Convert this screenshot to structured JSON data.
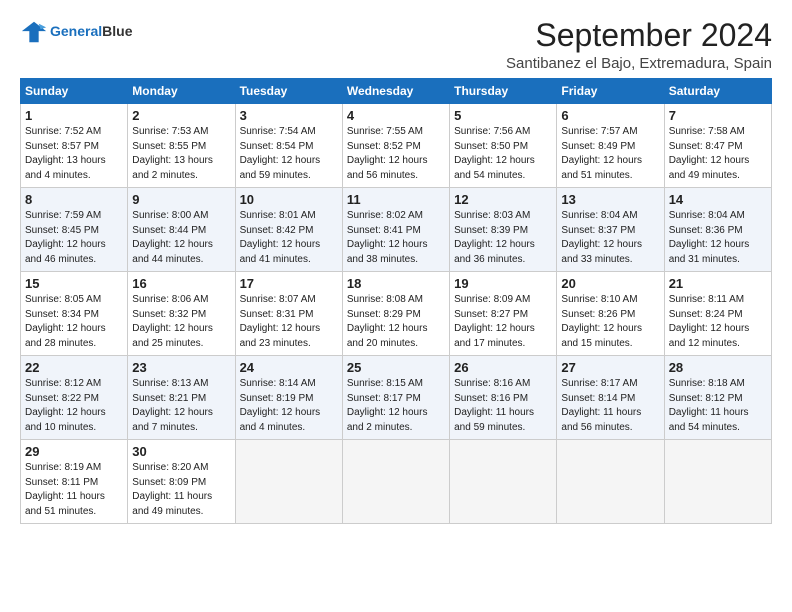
{
  "header": {
    "logo_line1": "General",
    "logo_line2": "Blue",
    "title": "September 2024",
    "subtitle": "Santibanez el Bajo, Extremadura, Spain"
  },
  "weekdays": [
    "Sunday",
    "Monday",
    "Tuesday",
    "Wednesday",
    "Thursday",
    "Friday",
    "Saturday"
  ],
  "weeks": [
    [
      {
        "day": "1",
        "info": "Sunrise: 7:52 AM\nSunset: 8:57 PM\nDaylight: 13 hours\nand 4 minutes."
      },
      {
        "day": "2",
        "info": "Sunrise: 7:53 AM\nSunset: 8:55 PM\nDaylight: 13 hours\nand 2 minutes."
      },
      {
        "day": "3",
        "info": "Sunrise: 7:54 AM\nSunset: 8:54 PM\nDaylight: 12 hours\nand 59 minutes."
      },
      {
        "day": "4",
        "info": "Sunrise: 7:55 AM\nSunset: 8:52 PM\nDaylight: 12 hours\nand 56 minutes."
      },
      {
        "day": "5",
        "info": "Sunrise: 7:56 AM\nSunset: 8:50 PM\nDaylight: 12 hours\nand 54 minutes."
      },
      {
        "day": "6",
        "info": "Sunrise: 7:57 AM\nSunset: 8:49 PM\nDaylight: 12 hours\nand 51 minutes."
      },
      {
        "day": "7",
        "info": "Sunrise: 7:58 AM\nSunset: 8:47 PM\nDaylight: 12 hours\nand 49 minutes."
      }
    ],
    [
      {
        "day": "8",
        "info": "Sunrise: 7:59 AM\nSunset: 8:45 PM\nDaylight: 12 hours\nand 46 minutes."
      },
      {
        "day": "9",
        "info": "Sunrise: 8:00 AM\nSunset: 8:44 PM\nDaylight: 12 hours\nand 44 minutes."
      },
      {
        "day": "10",
        "info": "Sunrise: 8:01 AM\nSunset: 8:42 PM\nDaylight: 12 hours\nand 41 minutes."
      },
      {
        "day": "11",
        "info": "Sunrise: 8:02 AM\nSunset: 8:41 PM\nDaylight: 12 hours\nand 38 minutes."
      },
      {
        "day": "12",
        "info": "Sunrise: 8:03 AM\nSunset: 8:39 PM\nDaylight: 12 hours\nand 36 minutes."
      },
      {
        "day": "13",
        "info": "Sunrise: 8:04 AM\nSunset: 8:37 PM\nDaylight: 12 hours\nand 33 minutes."
      },
      {
        "day": "14",
        "info": "Sunrise: 8:04 AM\nSunset: 8:36 PM\nDaylight: 12 hours\nand 31 minutes."
      }
    ],
    [
      {
        "day": "15",
        "info": "Sunrise: 8:05 AM\nSunset: 8:34 PM\nDaylight: 12 hours\nand 28 minutes."
      },
      {
        "day": "16",
        "info": "Sunrise: 8:06 AM\nSunset: 8:32 PM\nDaylight: 12 hours\nand 25 minutes."
      },
      {
        "day": "17",
        "info": "Sunrise: 8:07 AM\nSunset: 8:31 PM\nDaylight: 12 hours\nand 23 minutes."
      },
      {
        "day": "18",
        "info": "Sunrise: 8:08 AM\nSunset: 8:29 PM\nDaylight: 12 hours\nand 20 minutes."
      },
      {
        "day": "19",
        "info": "Sunrise: 8:09 AM\nSunset: 8:27 PM\nDaylight: 12 hours\nand 17 minutes."
      },
      {
        "day": "20",
        "info": "Sunrise: 8:10 AM\nSunset: 8:26 PM\nDaylight: 12 hours\nand 15 minutes."
      },
      {
        "day": "21",
        "info": "Sunrise: 8:11 AM\nSunset: 8:24 PM\nDaylight: 12 hours\nand 12 minutes."
      }
    ],
    [
      {
        "day": "22",
        "info": "Sunrise: 8:12 AM\nSunset: 8:22 PM\nDaylight: 12 hours\nand 10 minutes."
      },
      {
        "day": "23",
        "info": "Sunrise: 8:13 AM\nSunset: 8:21 PM\nDaylight: 12 hours\nand 7 minutes."
      },
      {
        "day": "24",
        "info": "Sunrise: 8:14 AM\nSunset: 8:19 PM\nDaylight: 12 hours\nand 4 minutes."
      },
      {
        "day": "25",
        "info": "Sunrise: 8:15 AM\nSunset: 8:17 PM\nDaylight: 12 hours\nand 2 minutes."
      },
      {
        "day": "26",
        "info": "Sunrise: 8:16 AM\nSunset: 8:16 PM\nDaylight: 11 hours\nand 59 minutes."
      },
      {
        "day": "27",
        "info": "Sunrise: 8:17 AM\nSunset: 8:14 PM\nDaylight: 11 hours\nand 56 minutes."
      },
      {
        "day": "28",
        "info": "Sunrise: 8:18 AM\nSunset: 8:12 PM\nDaylight: 11 hours\nand 54 minutes."
      }
    ],
    [
      {
        "day": "29",
        "info": "Sunrise: 8:19 AM\nSunset: 8:11 PM\nDaylight: 11 hours\nand 51 minutes."
      },
      {
        "day": "30",
        "info": "Sunrise: 8:20 AM\nSunset: 8:09 PM\nDaylight: 11 hours\nand 49 minutes."
      },
      {
        "day": "",
        "info": ""
      },
      {
        "day": "",
        "info": ""
      },
      {
        "day": "",
        "info": ""
      },
      {
        "day": "",
        "info": ""
      },
      {
        "day": "",
        "info": ""
      }
    ]
  ]
}
